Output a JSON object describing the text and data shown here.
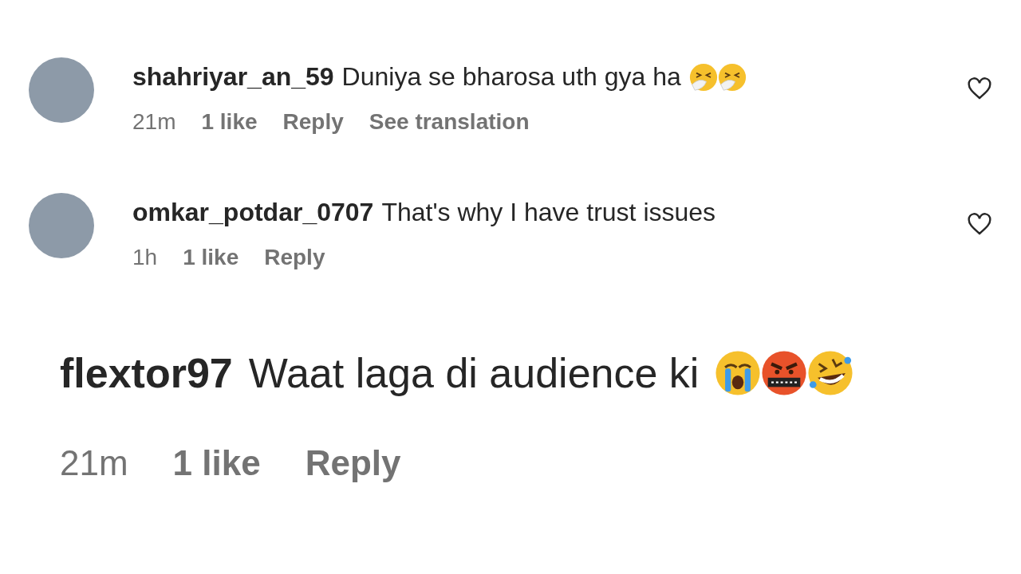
{
  "comments": [
    {
      "kind": "normal",
      "username": "shahriyar_an_59",
      "text": "Duniya se bharosa uth gya ha",
      "emojis": [
        {
          "kind": "sneezing"
        },
        {
          "kind": "sneezing"
        }
      ],
      "time": "21m",
      "likes": "1 like",
      "reply": "Reply",
      "translation": "See translation",
      "liked": false
    },
    {
      "kind": "normal",
      "username": "omkar_potdar_0707",
      "text": "That's why I have trust issues",
      "time": "1h",
      "likes": "1 like",
      "reply": "Reply",
      "liked": false
    },
    {
      "kind": "enlarged",
      "username": "flextor97",
      "text": "Waat laga di audience ki",
      "emojis": [
        {
          "kind": "crying"
        },
        {
          "kind": "cursing"
        },
        {
          "kind": "rolling-laughing"
        }
      ],
      "time": "21m",
      "likes": "1 like",
      "reply": "Reply"
    }
  ]
}
